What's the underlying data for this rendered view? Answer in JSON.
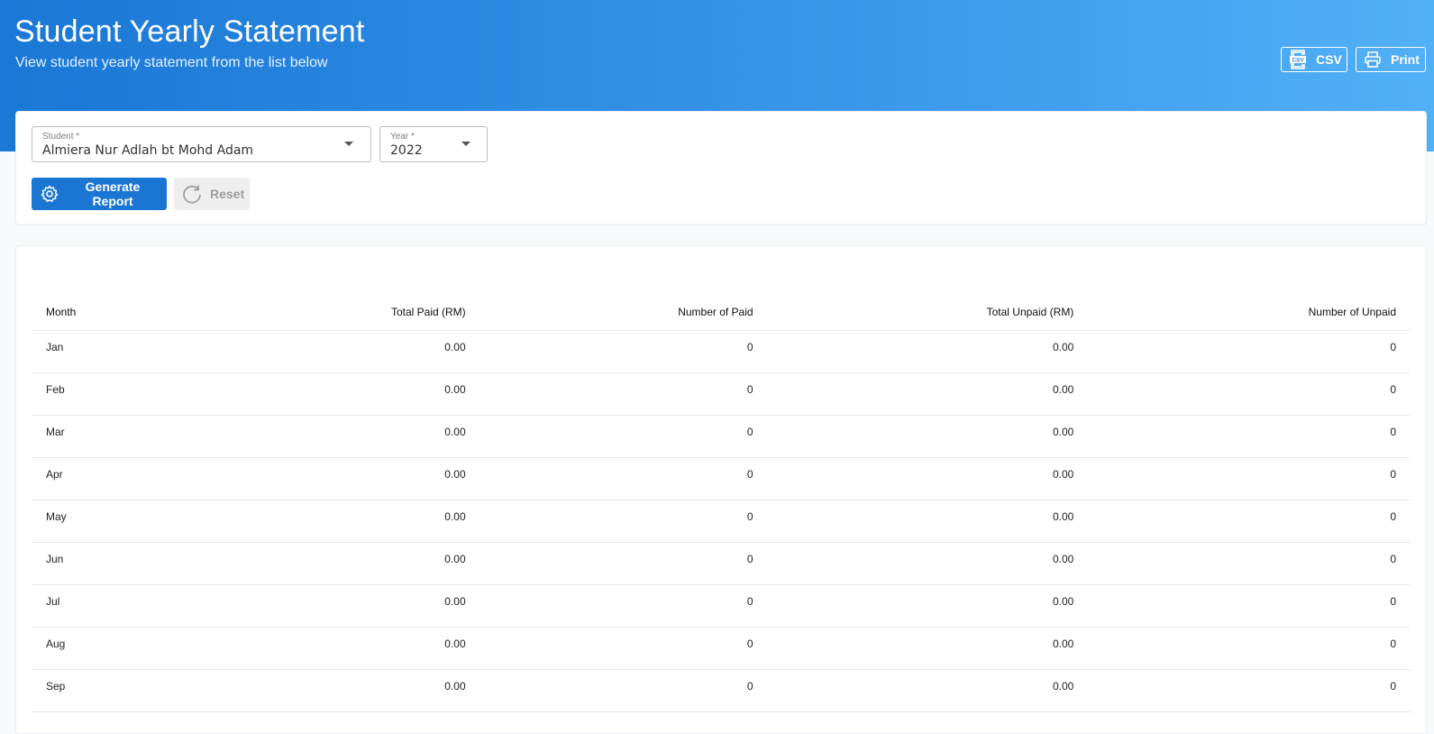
{
  "header": {
    "title": "Student Yearly Statement",
    "subtitle": "View student yearly statement from the list below",
    "csv_label": "CSV",
    "print_label": "Print",
    "colors": {
      "gradient_start": "#1a78d6",
      "gradient_end": "#52b0f6"
    }
  },
  "filters": {
    "student_label": "Student *",
    "student_value": "Almiera Nur Adlah bt Mohd Adam",
    "year_label": "Year *",
    "year_value": "2022",
    "generate_label": "Generate Report",
    "reset_label": "Reset"
  },
  "table": {
    "columns": [
      "Month",
      "Total Paid (RM)",
      "Number of Paid",
      "Total Unpaid (RM)",
      "Number of Unpaid"
    ],
    "rows": [
      [
        "Jan",
        "0.00",
        "0",
        "0.00",
        "0"
      ],
      [
        "Feb",
        "0.00",
        "0",
        "0.00",
        "0"
      ],
      [
        "Mar",
        "0.00",
        "0",
        "0.00",
        "0"
      ],
      [
        "Apr",
        "0.00",
        "0",
        "0.00",
        "0"
      ],
      [
        "May",
        "0.00",
        "0",
        "0.00",
        "0"
      ],
      [
        "Jun",
        "0.00",
        "0",
        "0.00",
        "0"
      ],
      [
        "Jul",
        "0.00",
        "0",
        "0.00",
        "0"
      ],
      [
        "Aug",
        "0.00",
        "0",
        "0.00",
        "0"
      ],
      [
        "Sep",
        "0.00",
        "0",
        "0.00",
        "0"
      ]
    ]
  },
  "icons": [
    "csv-file-icon",
    "printer-icon",
    "gear-icon",
    "refresh-icon",
    "chevron-down-icon"
  ]
}
